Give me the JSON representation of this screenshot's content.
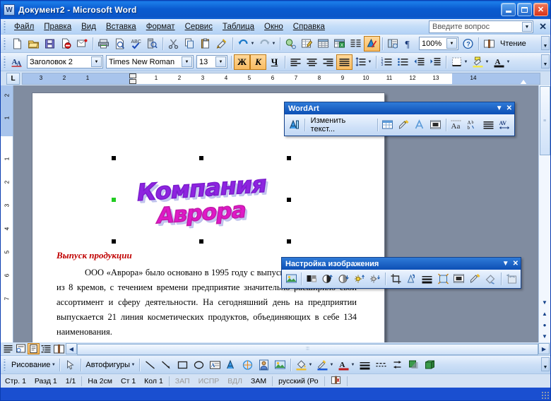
{
  "window": {
    "title": "Документ2 - Microsoft Word",
    "app_icon": "word-document-icon",
    "minimize": "_",
    "maximize": "□",
    "close": "✕"
  },
  "menu": {
    "items": [
      "Файл",
      "Правка",
      "Вид",
      "Вставка",
      "Формат",
      "Сервис",
      "Таблица",
      "Окно",
      "Справка"
    ],
    "question_box_placeholder": "Введите вопрос",
    "close_label": "✕"
  },
  "standard_toolbar": {
    "buttons": [
      "new-document",
      "open-folder",
      "save-disk",
      "permission",
      "email",
      "print",
      "print-preview",
      "spelling-check",
      "research",
      "cut-scissors",
      "copy",
      "paste",
      "format-painter",
      "undo",
      "redo",
      "insert-hyperlink",
      "tables-and-borders",
      "insert-table",
      "insert-excel-spreadsheet",
      "columns",
      "drawing",
      "document-map",
      "show-formatting"
    ],
    "zoom_value": "100%",
    "help_button": "?",
    "reading_label": "Чтение",
    "reading_icon": "book-icon"
  },
  "formatting_toolbar": {
    "styles_icon": "styles-and-formatting-icon",
    "style_value": "Заголовок 2",
    "font_value": "Times New Roman",
    "size_value": "13",
    "bold_label": "Ж",
    "italic_label": "К",
    "underline_label": "Ч",
    "bold_active": true,
    "italic_active": true,
    "align_active": "justify",
    "buttons": [
      "align-left",
      "align-center",
      "align-right",
      "align-justify",
      "line-spacing",
      "numbering",
      "bullets",
      "decrease-indent",
      "increase-indent",
      "borders",
      "highlight-color",
      "font-color"
    ]
  },
  "ruler": {
    "tab_stop_label": "L",
    "horizontal_numbers": [
      "3",
      "2",
      "1",
      "1",
      "2",
      "3",
      "4",
      "5",
      "6",
      "7",
      "8",
      "9",
      "10",
      "11",
      "12",
      "13",
      "14"
    ],
    "vertical_numbers": [
      "2",
      "1",
      "1",
      "2",
      "3",
      "4",
      "5",
      "6",
      "7"
    ]
  },
  "document": {
    "wordart": {
      "line1": "Компания",
      "line2": "Аврора",
      "line1_color": "#8e24e0",
      "line2_color": "#e018c8",
      "selected": true
    },
    "heading": "Выпуск продукции",
    "heading_color": "#c00000",
    "body": "ООО «Аврора» было основано в 1995 году с выпуска небольшой серии из 8 кремов, с течением времени предприятие значительно расширило свой ассортимент и сферу деятельности. На сегодняшний день на предприятии выпускается 21 линия косметических продуктов, объединяющих в себе 134 наименования."
  },
  "wordart_toolbar": {
    "title": "WordArt",
    "edit_text_label": "Изменить текст...",
    "collapse_label": "▼",
    "close_label": "✕",
    "buttons": [
      "insert-wordart",
      "wordart-gallery",
      "format-wordart",
      "wordart-shape",
      "text-wrapping",
      "same-letter-heights",
      "wordart-vertical-text",
      "wordart-alignment",
      "wordart-character-spacing"
    ]
  },
  "picture_toolbar": {
    "title": "Настройка изображения",
    "collapse_label": "▼",
    "close_label": "✕",
    "buttons": [
      "insert-picture",
      "color",
      "more-contrast",
      "less-contrast",
      "more-brightness",
      "less-brightness",
      "crop",
      "rotate-left",
      "line-style",
      "compress-pictures",
      "text-wrapping",
      "format-picture",
      "set-transparent-color",
      "reset-picture"
    ]
  },
  "view_bar": {
    "buttons": [
      "normal-view",
      "web-layout-view",
      "print-layout-view",
      "outline-view",
      "reading-layout-view"
    ],
    "active": "print-layout-view"
  },
  "drawing_toolbar": {
    "draw_label": "Рисование",
    "select_icon": "select-objects-icon",
    "autoshapes_label": "Автофигуры",
    "buttons": [
      "line",
      "arrow",
      "rectangle",
      "oval",
      "text-box",
      "insert-wordart",
      "insert-diagram",
      "insert-clip-art",
      "insert-picture",
      "fill-color",
      "line-color",
      "font-color",
      "line-style",
      "dash-style",
      "arrow-style",
      "shadow-style",
      "3d-style"
    ]
  },
  "status_bar": {
    "page": "Стр. 1",
    "section": "Разд 1",
    "pages": "1/1",
    "at": "На 2см",
    "line": "Ст 1",
    "column": "Кол 1",
    "rec": "ЗАП",
    "trk": "ИСПР",
    "ext": "ВДЛ",
    "ovr": "ЗАМ",
    "language": "русский (Ро",
    "spell_icon": "spelling-status-icon"
  }
}
